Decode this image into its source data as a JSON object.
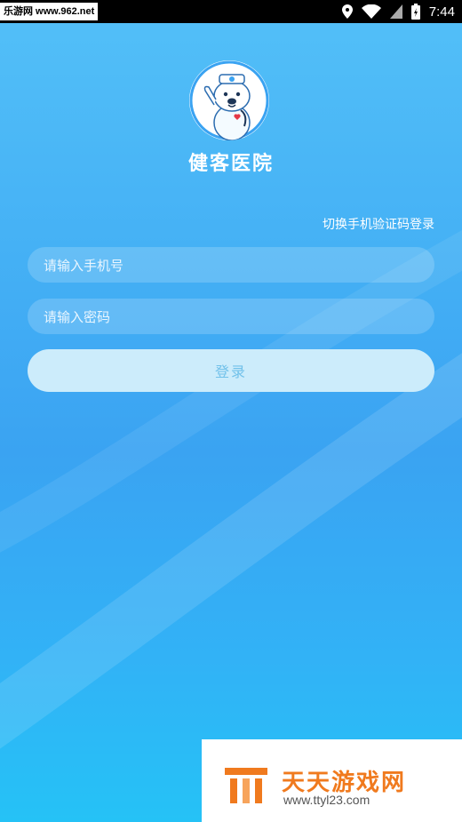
{
  "status_bar": {
    "site_watermark": "乐游网 www.962.net",
    "time": "7:44"
  },
  "app": {
    "name": "健客医院"
  },
  "login": {
    "switch_label": "切换手机验证码登录",
    "phone_placeholder": "请输入手机号",
    "password_placeholder": "请输入密码",
    "submit_label": "登录"
  },
  "watermark": {
    "title": "天天游戏网",
    "url": "www.ttyl23.com"
  },
  "colors": {
    "accent": "#3aa3f2",
    "button_bg": "#ccecfb",
    "button_text": "#71c1ea"
  },
  "icons": [
    "location-icon",
    "wifi-icon",
    "signal-icon",
    "battery-icon"
  ]
}
